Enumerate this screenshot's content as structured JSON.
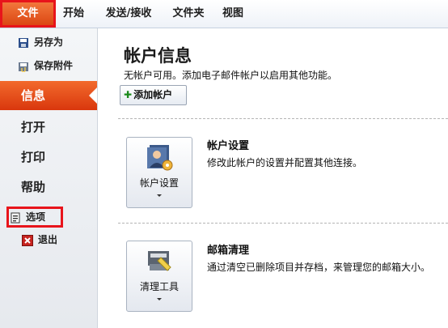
{
  "ribbon": {
    "tabs": [
      {
        "label": "文件"
      },
      {
        "label": "开始"
      },
      {
        "label": "发送/接收"
      },
      {
        "label": "文件夹"
      },
      {
        "label": "视图"
      }
    ]
  },
  "backstage": {
    "commands": {
      "save_as": "另存为",
      "save_attachments": "保存附件",
      "options": "选项",
      "exit": "退出"
    },
    "tabs": {
      "info": "信息",
      "open": "打开",
      "print": "打印",
      "help": "帮助"
    }
  },
  "main": {
    "title": "帐户信息",
    "subtitle": "无帐户可用。添加电子邮件帐户以启用其他功能。",
    "add_account_label": "添加帐户",
    "sections": [
      {
        "button_label": "帐户设置",
        "title": "帐户设置",
        "description": "修改此帐户的设置并配置其他连接。"
      },
      {
        "button_label": "清理工具",
        "title": "邮箱清理",
        "description": "通过清空已删除项目并存档，来管理您的邮箱大小。"
      }
    ]
  },
  "colors": {
    "file_tab": "#d9420f",
    "highlight_box": "#e8141b",
    "add_icon": "#1c8a1c"
  }
}
